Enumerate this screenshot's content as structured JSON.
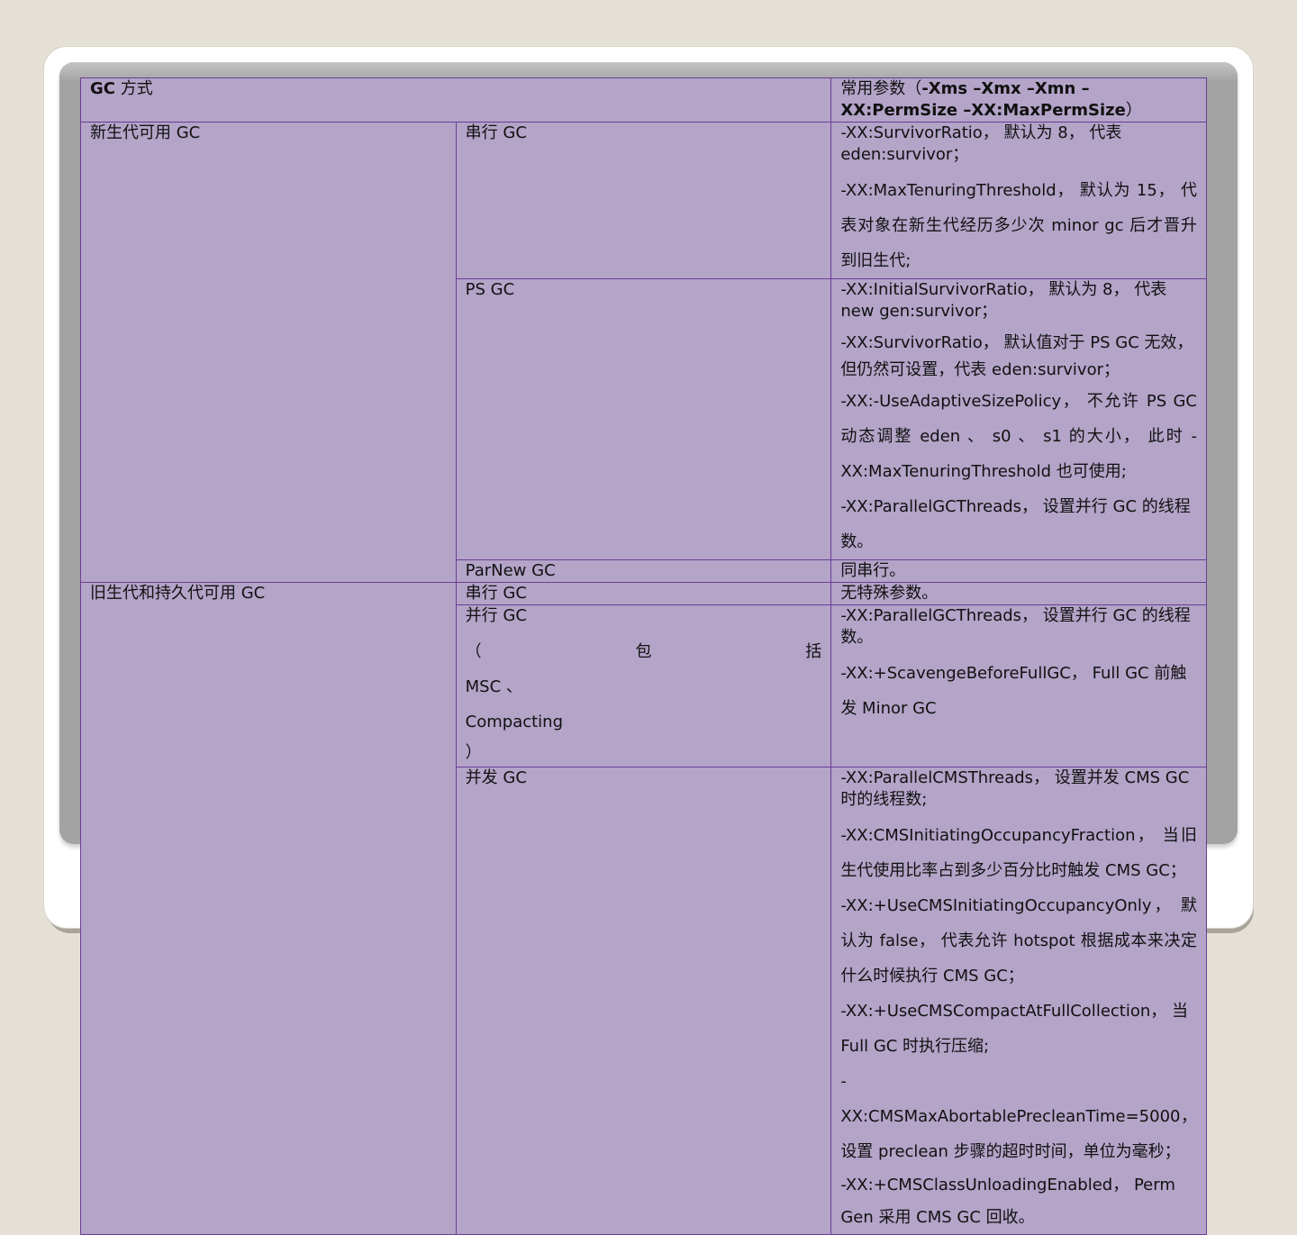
{
  "header": {
    "col1_bold": "GC",
    "col1_rest": " 方式",
    "col2_prefix": "常用参数（",
    "col2_bold": "-Xms –Xmx –Xmn –XX:PermSize –XX:MaxPermSize",
    "col2_suffix": "）"
  },
  "young": {
    "label": "新生代可用 GC",
    "serial": {
      "name": "串行 GC",
      "params": [
        "-XX:SurvivorRatio， 默认为 8， 代表 eden:survivor；",
        "-XX:MaxTenuringThreshold， 默认为 15， 代表对象在新生代经历多少次 minor gc 后才晋升到旧生代;"
      ]
    },
    "ps": {
      "name": "PS GC",
      "params": [
        "-XX:InitialSurvivorRatio， 默认为 8， 代表 new gen:survivor；",
        "-XX:SurvivorRatio， 默认值对于 PS GC 无效，但仍然可设置，代表 eden:survivor；",
        "-XX:-UseAdaptiveSizePolicy， 不允许 PS GC 动态调整 eden 、 s0 、 s1 的大小， 此时 -XX:MaxTenuringThreshold 也可使用;",
        "-XX:ParallelGCThreads， 设置并行 GC 的线程数。"
      ]
    },
    "parnew": {
      "name": "ParNew GC",
      "params": [
        "同串行。"
      ]
    }
  },
  "old": {
    "label": "旧生代和持久代可用 GC",
    "serial": {
      "name": "串行 GC",
      "params": [
        "无特殊参数。"
      ]
    },
    "parallel": {
      "name_line1": "并行 GC",
      "name_line2": "（ 包 括",
      "name_line3": "MSC 、",
      "name_line4": "Compacting",
      "name_line5": "）",
      "params": [
        "-XX:ParallelGCThreads， 设置并行 GC 的线程数。",
        "-XX:+ScavengeBeforeFullGC， Full GC 前触发 Minor GC"
      ]
    },
    "concurrent": {
      "name": "并发 GC",
      "params": [
        "-XX:ParallelCMSThreads， 设置并发 CMS GC 时的线程数;",
        "-XX:CMSInitiatingOccupancyFraction， 当旧生代使用比率占到多少百分比时触发 CMS GC；",
        "-XX:+UseCMSInitiatingOccupancyOnly， 默认为 false， 代表允许 hotspot 根据成本来决定什么时候执行 CMS GC；",
        "-XX:+UseCMSCompactAtFullCollection， 当 Full GC 时执行压缩;",
        "-XX:CMSMaxAbortablePrecleanTime=5000， 设置 preclean 步骤的超时时间，单位为毫秒；",
        "-XX:+CMSClassUnloadingEnabled， Perm Gen 采用 CMS GC 回收。"
      ]
    }
  }
}
